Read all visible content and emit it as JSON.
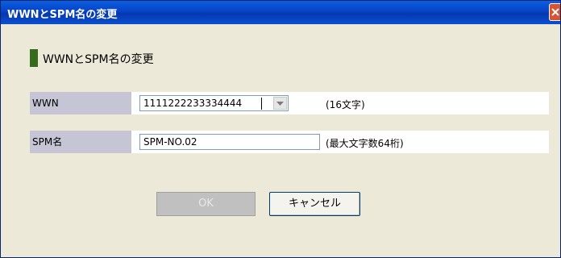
{
  "window": {
    "title": "WWNとSPM名の変更"
  },
  "heading": {
    "text": "WWNとSPM名の変更"
  },
  "fields": {
    "wwn": {
      "label": "WWN",
      "value": "1111222233334444",
      "hint": "(16文字)"
    },
    "spm": {
      "label": "SPM名",
      "value": "SPM-NO.02",
      "hint": "(最大文字数64桁)"
    }
  },
  "buttons": {
    "ok": "OK",
    "cancel": "キャンセル"
  },
  "colors": {
    "title_bar": "#0842c8",
    "heading_marker": "#356b1a",
    "label_bg": "#c5c5d6"
  },
  "icons": {
    "close": "close-icon",
    "dropdown": "chevron-down-icon"
  }
}
